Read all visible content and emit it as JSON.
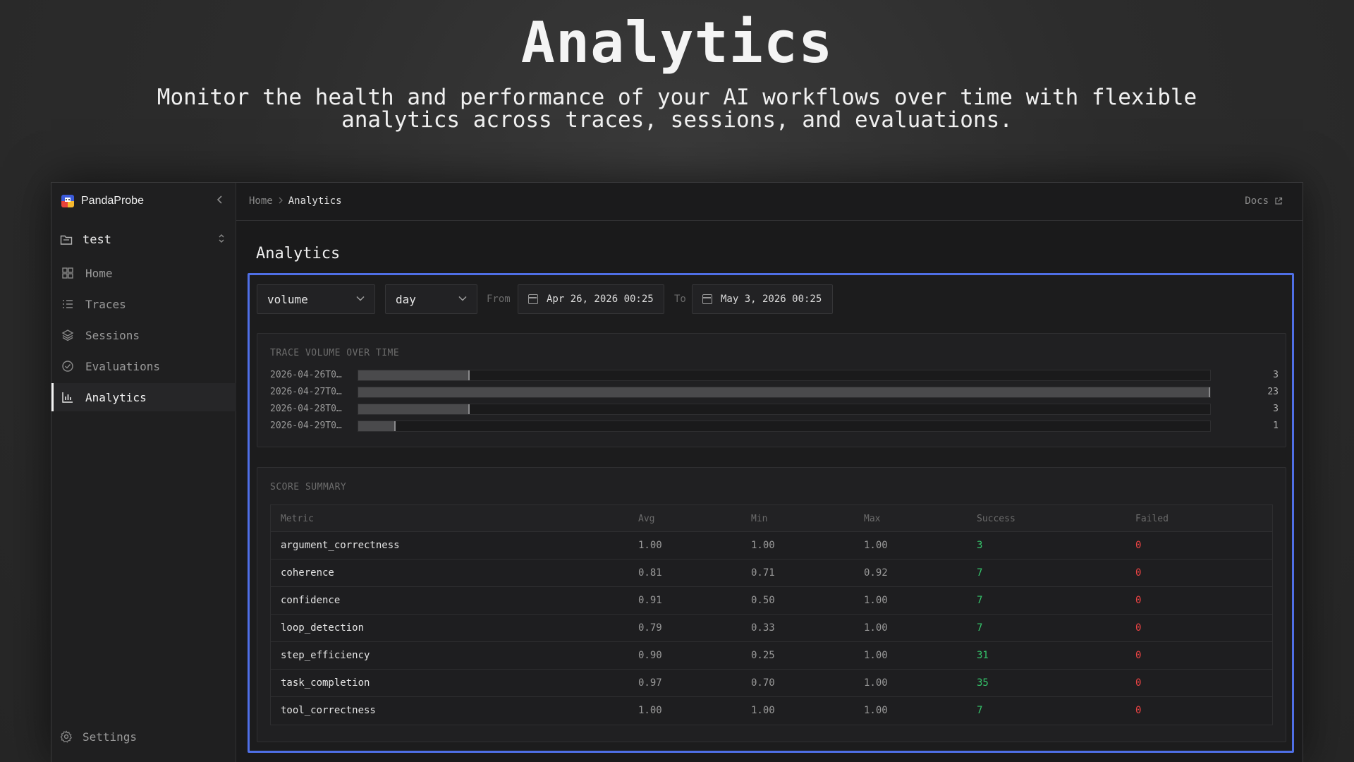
{
  "hero": {
    "title": "Analytics",
    "subtitle": "Monitor the health and performance of your AI workflows over time with flexible analytics across traces, sessions, and evaluations."
  },
  "sidebar": {
    "brand": "PandaProbe",
    "project": "test",
    "items": [
      {
        "label": "Home",
        "icon": "home-grid-icon",
        "active": false
      },
      {
        "label": "Traces",
        "icon": "traces-list-icon",
        "active": false
      },
      {
        "label": "Sessions",
        "icon": "layers-icon",
        "active": false
      },
      {
        "label": "Evaluations",
        "icon": "check-circle-icon",
        "active": false
      },
      {
        "label": "Analytics",
        "icon": "bar-chart-icon",
        "active": true
      }
    ],
    "settings": "Settings"
  },
  "topbar": {
    "breadcrumb": [
      "Home",
      "Analytics"
    ],
    "docs": "Docs"
  },
  "page": {
    "title": "Analytics"
  },
  "filters": {
    "metric": "volume",
    "granularity": "day",
    "from_label": "From",
    "from": "Apr 26, 2026 00:25",
    "to_label": "To",
    "to": "May 3, 2026 00:25"
  },
  "volume": {
    "title": "TRACE VOLUME OVER TIME",
    "max": 23,
    "rows": [
      {
        "label": "2026-04-26T0…",
        "value": 3
      },
      {
        "label": "2026-04-27T0…",
        "value": 23
      },
      {
        "label": "2026-04-28T0…",
        "value": 3
      },
      {
        "label": "2026-04-29T0…",
        "value": 1
      }
    ]
  },
  "scores": {
    "title": "SCORE SUMMARY",
    "headers": [
      "Metric",
      "Avg",
      "Min",
      "Max",
      "Success",
      "Failed"
    ],
    "rows": [
      {
        "metric": "argument_correctness",
        "avg": "1.00",
        "min": "1.00",
        "max": "1.00",
        "success": "3",
        "failed": "0"
      },
      {
        "metric": "coherence",
        "avg": "0.81",
        "min": "0.71",
        "max": "0.92",
        "success": "7",
        "failed": "0"
      },
      {
        "metric": "confidence",
        "avg": "0.91",
        "min": "0.50",
        "max": "1.00",
        "success": "7",
        "failed": "0"
      },
      {
        "metric": "loop_detection",
        "avg": "0.79",
        "min": "0.33",
        "max": "1.00",
        "success": "7",
        "failed": "0"
      },
      {
        "metric": "step_efficiency",
        "avg": "0.90",
        "min": "0.25",
        "max": "1.00",
        "success": "31",
        "failed": "0"
      },
      {
        "metric": "task_completion",
        "avg": "0.97",
        "min": "0.70",
        "max": "1.00",
        "success": "35",
        "failed": "0"
      },
      {
        "metric": "tool_correctness",
        "avg": "1.00",
        "min": "1.00",
        "max": "1.00",
        "success": "7",
        "failed": "0"
      }
    ]
  },
  "colors": {
    "accent": "#4f6fe6",
    "success": "#35c46a",
    "failed": "#ef4444"
  }
}
